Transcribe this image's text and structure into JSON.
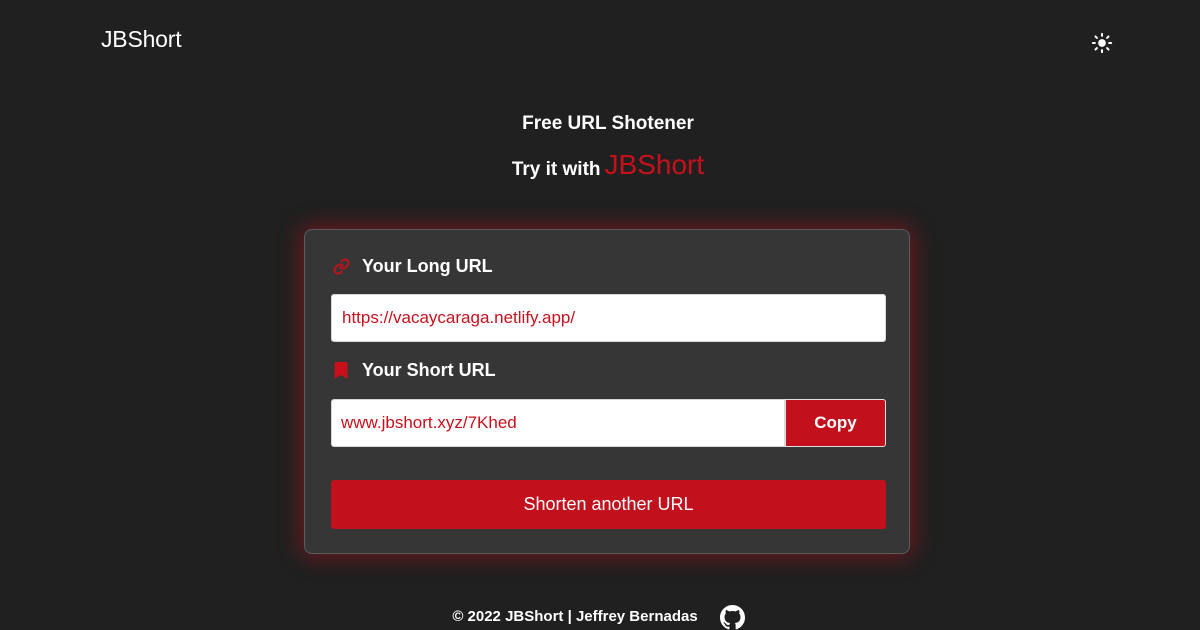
{
  "header": {
    "brand": "JBShort",
    "theme_toggle_icon": "sun-icon"
  },
  "hero": {
    "title": "Free URL Shotener",
    "subtitle_prefix": "Try it with",
    "subtitle_brand": "JBShort"
  },
  "form": {
    "long_url_label": "Your Long URL",
    "long_url_icon": "link-icon",
    "long_url_value": "https://vacaycaraga.netlify.app/",
    "short_url_label": "Your Short URL",
    "short_url_icon": "bookmark-icon",
    "short_url_value": "www.jbshort.xyz/7Khed",
    "copy_label": "Copy",
    "shorten_another_label": "Shorten another URL"
  },
  "footer": {
    "text": "© 2022 JBShort | Jeffrey Bernadas",
    "github_icon": "github-icon"
  },
  "colors": {
    "background": "#202020",
    "card": "#363636",
    "accent": "#c2101c",
    "text": "#ffffff"
  }
}
